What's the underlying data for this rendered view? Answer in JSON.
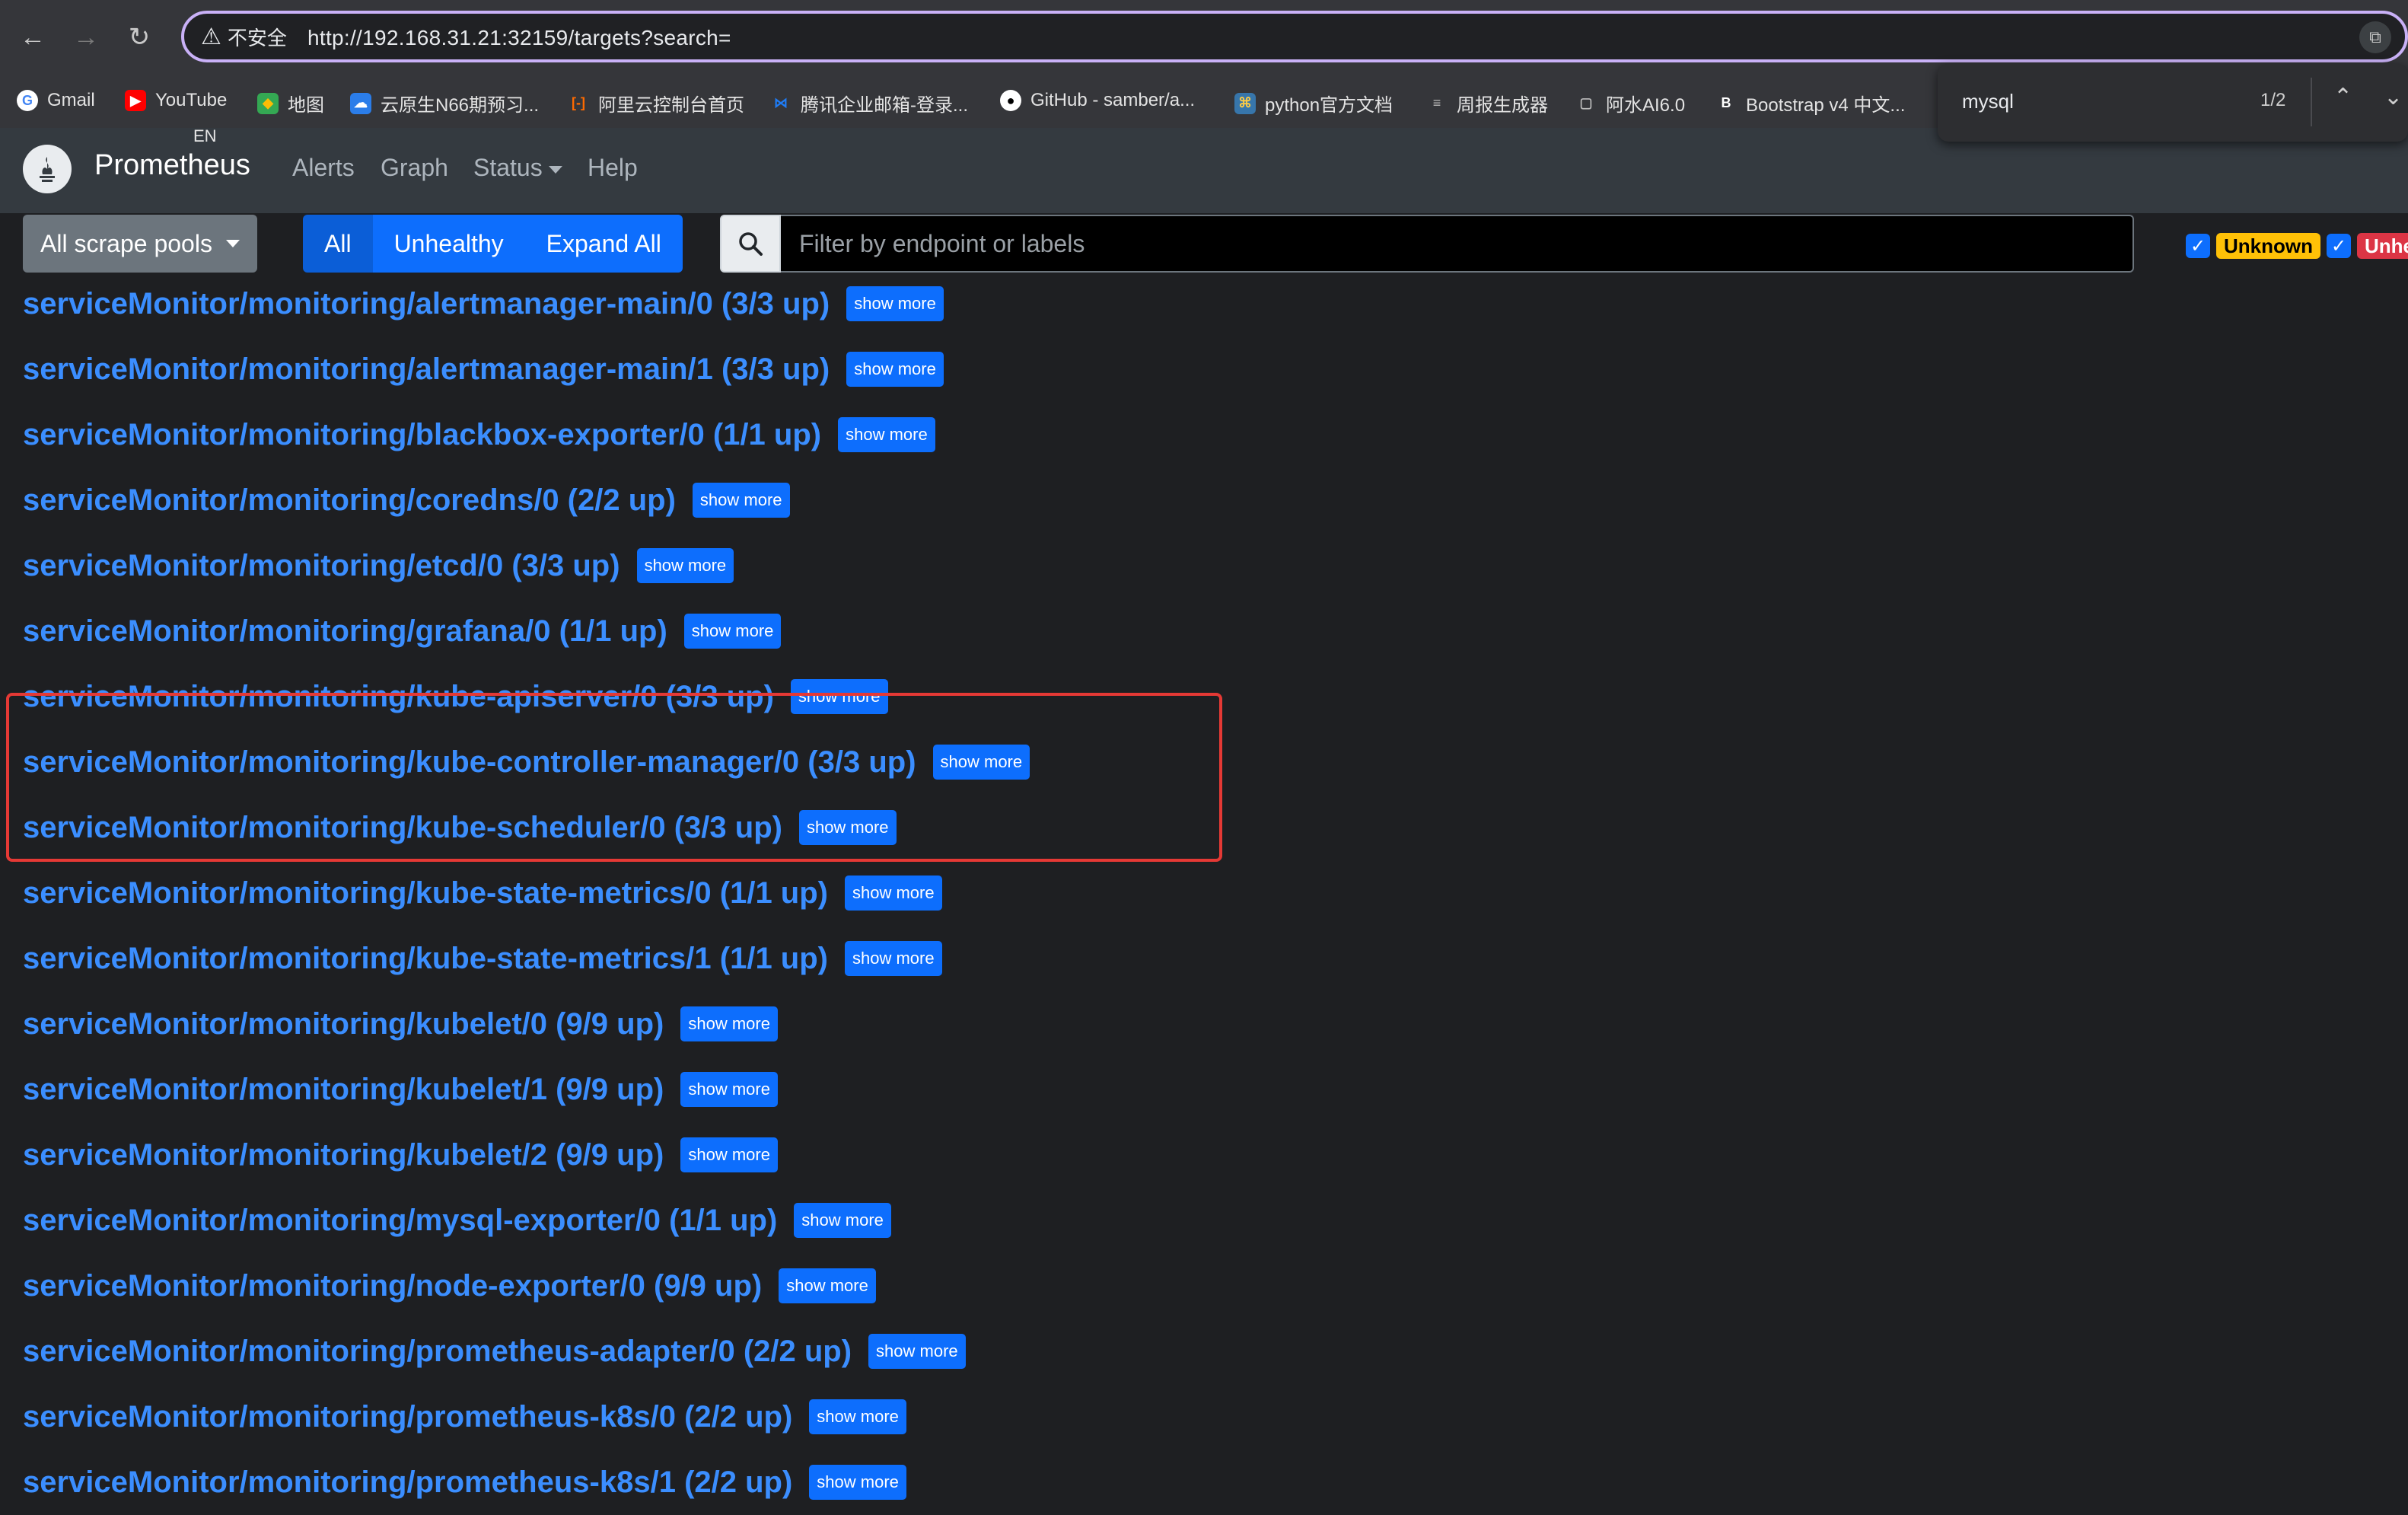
{
  "browser": {
    "security_label": "不安全",
    "url": "http://192.168.31.21:32159/targets?search=",
    "bookmarks": [
      {
        "label": "Gmail",
        "icon": "google-icon",
        "color": "#4285f4"
      },
      {
        "label": "YouTube",
        "icon": "youtube-icon",
        "color": "#ff0000"
      },
      {
        "label": "地图",
        "icon": "maps-icon",
        "color": "#34a853"
      },
      {
        "label": "云原生N66期预习...",
        "icon": "cloud-icon",
        "color": "#2b7de9"
      },
      {
        "label": "阿里云控制台首页",
        "icon": "aliyun-icon",
        "color": "#ff6a00"
      },
      {
        "label": "腾讯企业邮箱-登录...",
        "icon": "tencent-mail-icon",
        "color": "#1f7cf5"
      },
      {
        "label": "GitHub - samber/a...",
        "icon": "github-icon",
        "color": "#ffffff"
      },
      {
        "label": "python官方文档",
        "icon": "python-icon",
        "color": "#f7c948"
      },
      {
        "label": "周报生成器",
        "icon": "doc-icon",
        "color": "#bbbbbb"
      },
      {
        "label": "阿水AI6.0",
        "icon": "chat-icon",
        "color": "#bbbbbb"
      },
      {
        "label": "Bootstrap v4 中文...",
        "icon": "bootstrap-icon",
        "color": "#7952b3"
      }
    ],
    "ime_indicator": "EN",
    "find": {
      "query": "mysql",
      "count": "1/2"
    }
  },
  "navbar": {
    "brand": "Prometheus",
    "links": [
      "Alerts",
      "Graph",
      "Status",
      "Help"
    ]
  },
  "toolbar": {
    "scrape_pools_label": "All scrape pools",
    "filter_buttons": [
      "All",
      "Unhealthy",
      "Expand All"
    ],
    "search_placeholder": "Filter by endpoint or labels",
    "badges": [
      {
        "label": "Unknown",
        "color": "#ffc107"
      },
      {
        "label": "Unhe",
        "color": "#dc3545"
      }
    ]
  },
  "targets": {
    "show_more_label": "show more",
    "items": [
      "serviceMonitor/monitoring/alertmanager-main/0 (3/3 up)",
      "serviceMonitor/monitoring/alertmanager-main/1 (3/3 up)",
      "serviceMonitor/monitoring/blackbox-exporter/0 (1/1 up)",
      "serviceMonitor/monitoring/coredns/0 (2/2 up)",
      "serviceMonitor/monitoring/etcd/0 (3/3 up)",
      "serviceMonitor/monitoring/grafana/0 (1/1 up)",
      "serviceMonitor/monitoring/kube-apiserver/0 (3/3 up)",
      "serviceMonitor/monitoring/kube-controller-manager/0 (3/3 up)",
      "serviceMonitor/monitoring/kube-scheduler/0 (3/3 up)",
      "serviceMonitor/monitoring/kube-state-metrics/0 (1/1 up)",
      "serviceMonitor/monitoring/kube-state-metrics/1 (1/1 up)",
      "serviceMonitor/monitoring/kubelet/0 (9/9 up)",
      "serviceMonitor/monitoring/kubelet/1 (9/9 up)",
      "serviceMonitor/monitoring/kubelet/2 (9/9 up)",
      "serviceMonitor/monitoring/mysql-exporter/0 (1/1 up)",
      "serviceMonitor/monitoring/node-exporter/0 (9/9 up)",
      "serviceMonitor/monitoring/prometheus-adapter/0 (2/2 up)",
      "serviceMonitor/monitoring/prometheus-k8s/0 (2/2 up)",
      "serviceMonitor/monitoring/prometheus-k8s/1 (2/2 up)"
    ],
    "highlight_color": "#e53935"
  }
}
